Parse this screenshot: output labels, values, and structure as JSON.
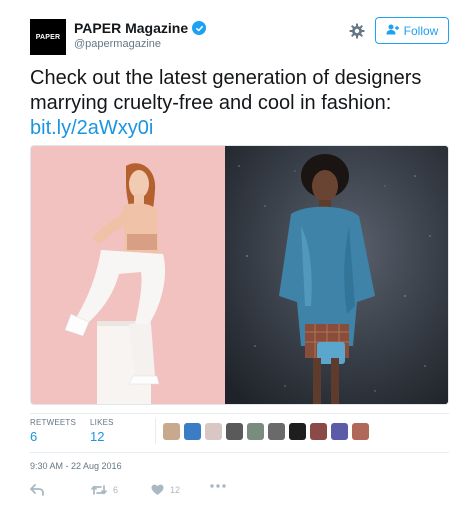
{
  "header": {
    "avatar_text": "PAPER",
    "display_name": "PAPER Magazine",
    "handle": "@papermagazine",
    "follow_label": "Follow"
  },
  "tweet": {
    "text_line1": "Check out the latest generation of designers",
    "text_line2": "marrying cruelty-free and cool in fashion:",
    "link": "bit.ly/2aWxy0i"
  },
  "media": {
    "left_photo": "photo",
    "right_photo": "photo"
  },
  "stats": {
    "retweets_label": "RETWEETS",
    "retweets_value": "6",
    "likes_label": "LIKES",
    "likes_value": "12"
  },
  "likers": [
    "#c9a98e",
    "#3b7dc4",
    "#d9c7c3",
    "#5a5a5a",
    "#7a8c7e",
    "#6a6a6a",
    "#1e1e1e",
    "#8b4a47",
    "#5b5ba8",
    "#b0685b"
  ],
  "timestamp": "9:30 AM - 22 Aug 2016",
  "actions": {
    "retweet_count": "6",
    "like_count": "12"
  },
  "colors": {
    "accent": "#1da1f2",
    "link": "#1b95e0",
    "muted": "#657786",
    "action_icon": "#aab8c2"
  },
  "icons": [
    "verified-icon",
    "gear-icon",
    "follow-person-icon",
    "reply-icon",
    "retweet-icon",
    "like-icon",
    "more-icon"
  ]
}
